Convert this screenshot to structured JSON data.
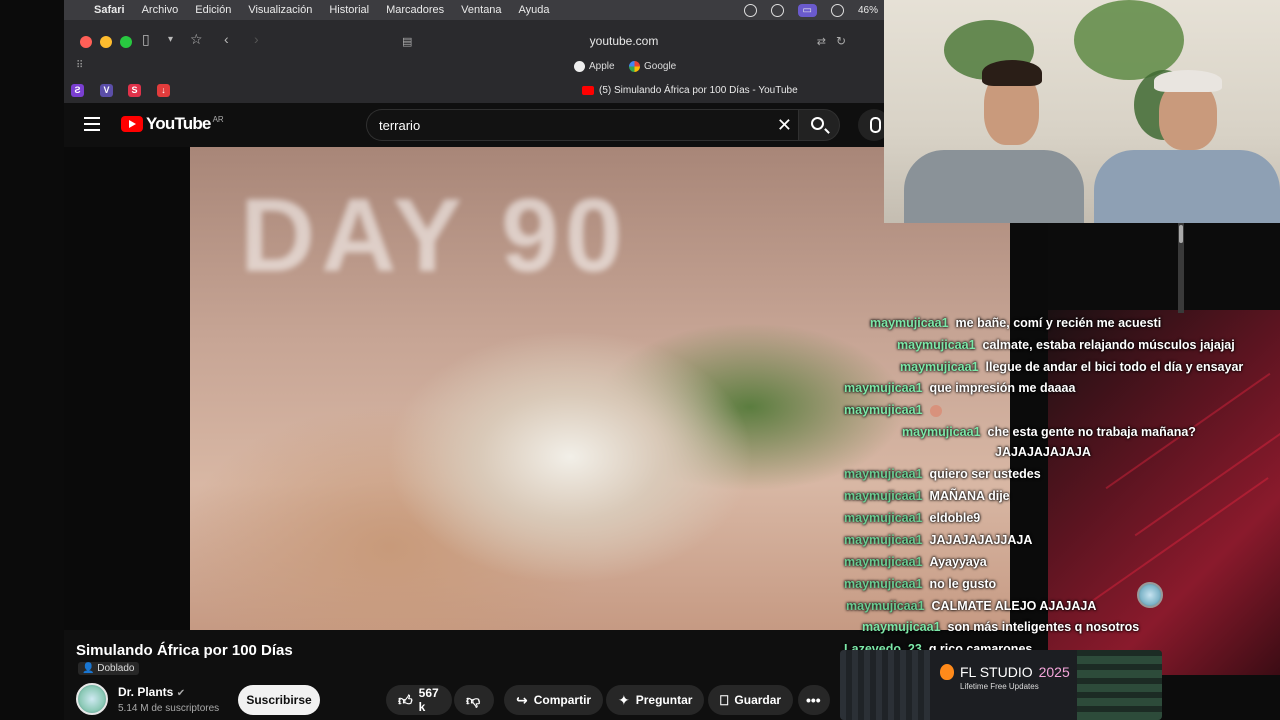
{
  "menubar": {
    "items": [
      "Safari",
      "Archivo",
      "Edición",
      "Visualización",
      "Historial",
      "Marcadores",
      "Ventana",
      "Ayuda"
    ],
    "battery": "46%"
  },
  "browser": {
    "url": "youtube.com",
    "favorites": [
      "Apple",
      "Google"
    ],
    "tab_title": "(5) Simulando África por 100 Días - YouTube"
  },
  "youtube": {
    "logo": "YouTube",
    "region": "AR",
    "search_value": "terrario"
  },
  "video": {
    "overlay_text": "DAY 90",
    "title": "Simulando África por 100 Días",
    "dub_badge": "Doblado",
    "channel": "Dr. Plants",
    "subscribers": "5.14 M de suscriptores",
    "subscribe_label": "Suscribirse",
    "likes": "567 k",
    "share_label": "Compartir",
    "ask_label": "Preguntar",
    "save_label": "Guardar"
  },
  "chat": [
    {
      "user": "maymujicaa1",
      "text": "me bañe, comí y recién me acuesti"
    },
    {
      "user": "maymujicaa1",
      "text": "calmate, estaba relajando músculos jajajaj"
    },
    {
      "user": "maymujicaa1",
      "text": "llegue de andar el bici todo el día y ensayar"
    },
    {
      "user": "maymujicaa1",
      "text": "que impresión me daaaa"
    },
    {
      "user": "maymujicaa1",
      "text": ""
    },
    {
      "user": "maymujicaa1",
      "text": "che esta gente no trabaja mañana?"
    },
    {
      "user": "",
      "text": "JAJAJAJAJAJA"
    },
    {
      "user": "maymujicaa1",
      "text": "quiero ser ustedes"
    },
    {
      "user": "maymujicaa1",
      "text": "MAÑANA dije"
    },
    {
      "user": "maymujicaa1",
      "text": "eldoble9"
    },
    {
      "user": "maymujicaa1",
      "text": "JAJAJAJAJJAJA"
    },
    {
      "user": "maymujicaa1",
      "text": "Ayayyaya"
    },
    {
      "user": "maymujicaa1",
      "text": "no le gusto"
    },
    {
      "user": "maymujicaa1",
      "text": "CALMATE ALEJO AJAJAJA"
    },
    {
      "user": "maymujicaa1",
      "text": "son más inteligentes q nosotros"
    },
    {
      "user": "Lazevedo_23",
      "text": "q rico camarones"
    }
  ],
  "ad": {
    "brand": "FL STUDIO",
    "year": "2025",
    "tagline": "Lifetime Free Updates"
  }
}
